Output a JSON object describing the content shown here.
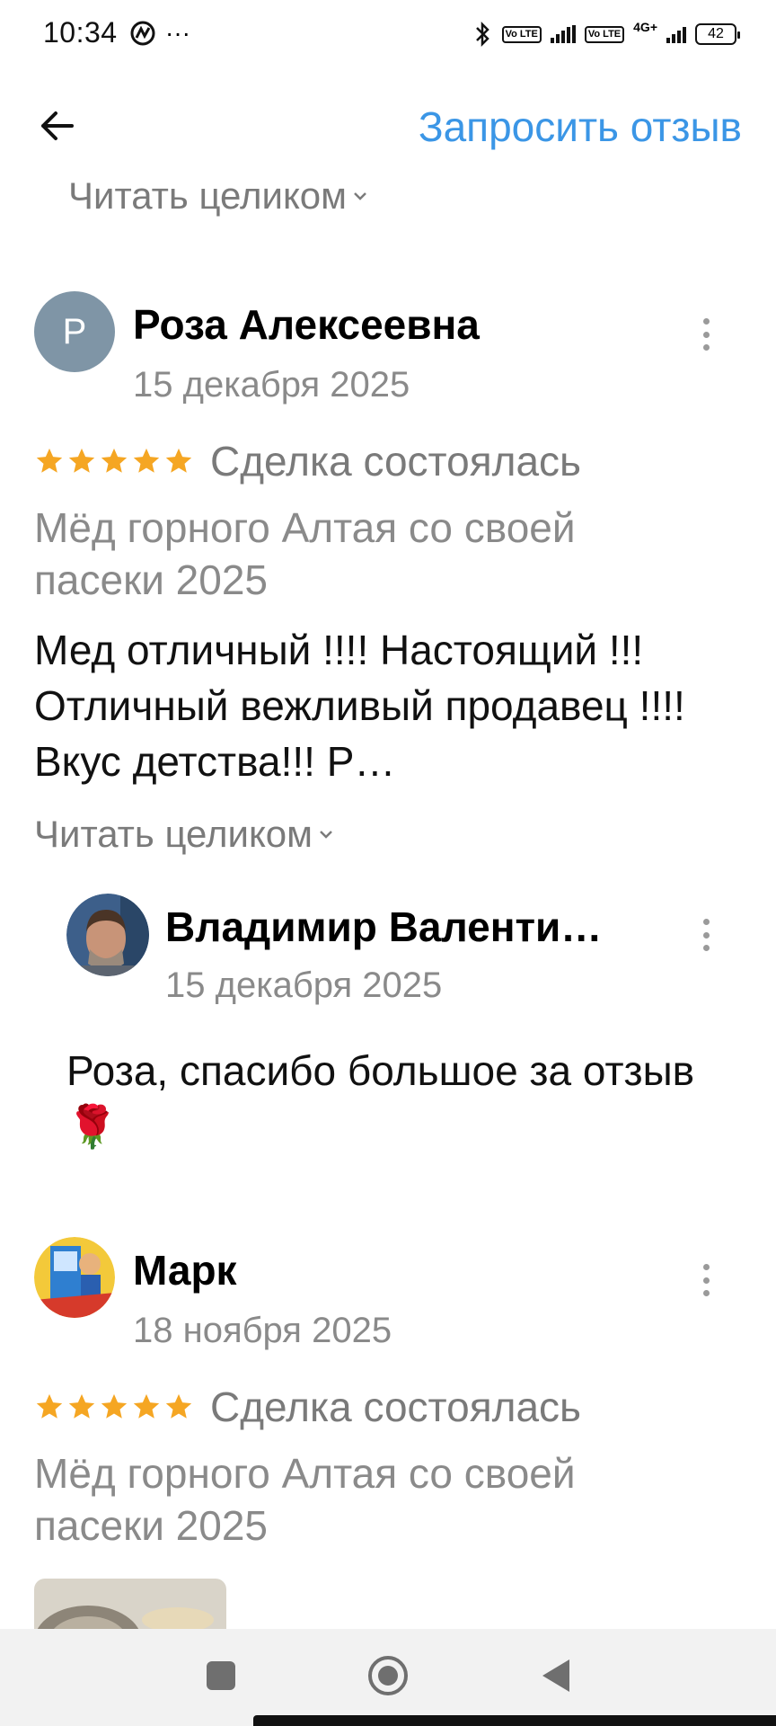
{
  "status_bar": {
    "time": "10:34",
    "dots": "···",
    "tag1": "Vo LTE",
    "tag2": "Vo LTE",
    "net": "4G+",
    "battery": "42"
  },
  "header": {
    "request_review": "Запросить отзыв",
    "read_full_top": "Читать целиком"
  },
  "reviews": [
    {
      "avatar_letter": "Р",
      "author": "Роза Алексеевна",
      "date": "15 декабря 2025",
      "rating": 5,
      "deal_status": "Сделка состоялась",
      "product": "Мёд горного Алтая со своей пасеки 2025",
      "text": "Мед отличный !!!! Настоящий !!! Отличный вежливый продавец !!!! Вкус детства!!! Р…",
      "read_more": "Читать целиком",
      "reply": {
        "author": "Владимир Валенти…",
        "date": "15 декабря 2025",
        "text": "Роза, спасибо большое за отзыв 🌹"
      }
    },
    {
      "author": "Марк",
      "date": "18 ноября 2025",
      "rating": 5,
      "deal_status": "Сделка состоялась",
      "product": "Мёд горного Алтая со своей пасеки 2025"
    }
  ],
  "colors": {
    "accent": "#3b96e6",
    "star": "#f5a623",
    "muted": "#8a8a8a"
  }
}
